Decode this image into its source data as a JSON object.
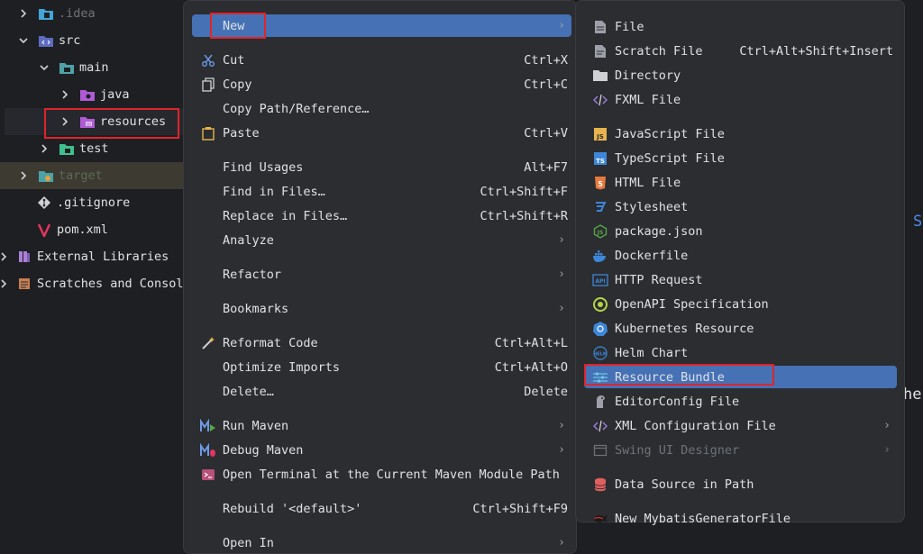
{
  "tree": {
    "items": [
      {
        "label": ".idea",
        "icon": "folder-idea-icon"
      },
      {
        "label": "src",
        "icon": "folder-src-icon"
      },
      {
        "label": "main",
        "icon": "folder-module-icon"
      },
      {
        "label": "java",
        "icon": "folder-java-source-icon"
      },
      {
        "label": "resources",
        "icon": "folder-resources-icon"
      },
      {
        "label": "test",
        "icon": "folder-test-icon"
      },
      {
        "label": "target",
        "icon": "folder-excluded-icon"
      },
      {
        "label": ".gitignore",
        "icon": "git-icon"
      },
      {
        "label": "pom.xml",
        "icon": "maven-icon"
      },
      {
        "label": "External Libraries",
        "icon": "library-icon"
      },
      {
        "label": "Scratches and Consol",
        "icon": "scratches-icon"
      }
    ]
  },
  "edge_text": {
    "s": "S",
    "he": "he"
  },
  "context_menu": {
    "new": "New",
    "cut": "Cut",
    "cut_sc": "Ctrl+X",
    "copy": "Copy",
    "copy_sc": "Ctrl+C",
    "copy_path": "Copy Path/Reference…",
    "paste": "Paste",
    "paste_sc": "Ctrl+V",
    "find_usages": "Find Usages",
    "find_usages_sc": "Alt+F7",
    "find_in_files": "Find in Files…",
    "find_in_files_sc": "Ctrl+Shift+F",
    "replace_in_files": "Replace in Files…",
    "replace_in_files_sc": "Ctrl+Shift+R",
    "analyze": "Analyze",
    "refactor": "Refactor",
    "bookmarks": "Bookmarks",
    "reformat": "Reformat Code",
    "reformat_sc": "Ctrl+Alt+L",
    "optimize": "Optimize Imports",
    "optimize_sc": "Ctrl+Alt+O",
    "delete": "Delete…",
    "delete_sc": "Delete",
    "run_maven": "Run Maven",
    "debug_maven": "Debug Maven",
    "open_terminal": "Open Terminal at the Current Maven Module Path",
    "rebuild": "Rebuild '<default>'",
    "rebuild_sc": "Ctrl+Shift+F9",
    "open_in": "Open In"
  },
  "new_submenu": {
    "file": "File",
    "scratch": "Scratch File",
    "scratch_sc": "Ctrl+Alt+Shift+Insert",
    "directory": "Directory",
    "fxml": "FXML File",
    "javascript": "JavaScript File",
    "typescript": "TypeScript File",
    "html": "HTML File",
    "stylesheet": "Stylesheet",
    "package_json": "package.json",
    "dockerfile": "Dockerfile",
    "http_request": "HTTP Request",
    "openapi": "OpenAPI Specification",
    "kubernetes": "Kubernetes Resource",
    "helm": "Helm Chart",
    "resource_bundle": "Resource Bundle",
    "editorconfig": "EditorConfig File",
    "xml_config": "XML Configuration File",
    "swing": "Swing UI Designer",
    "datasource": "Data Source in Path",
    "mybatis": "New MybatisGeneratorFile"
  },
  "colors": {
    "background": "#1e1f22",
    "menu_bg": "#2b2d30",
    "highlight": "#4672b5",
    "annotation_red": "#e0242b"
  }
}
